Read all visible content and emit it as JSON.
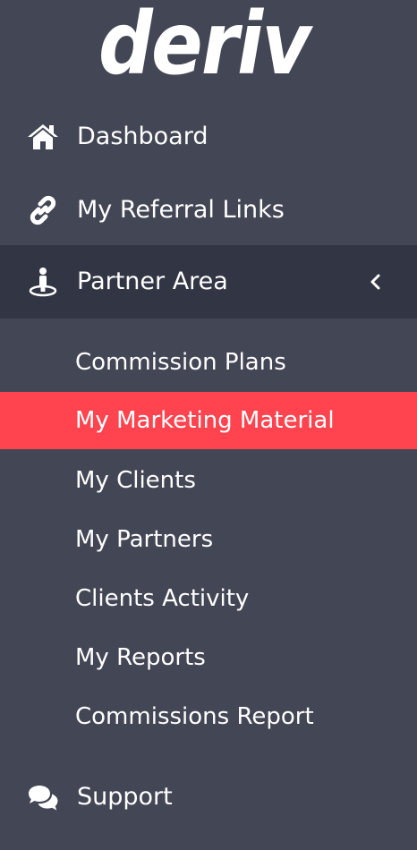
{
  "brand": {
    "logo_text": "deriv"
  },
  "nav": {
    "dashboard": {
      "label": "Dashboard",
      "icon": "home-icon"
    },
    "referral_links": {
      "label": "My Referral Links",
      "icon": "link-icon"
    },
    "partner_area": {
      "label": "Partner Area",
      "icon": "partner-icon",
      "expanded": true,
      "children": [
        {
          "label": "Commission Plans"
        },
        {
          "label": "My Marketing Material",
          "selected": true
        },
        {
          "label": "My Clients"
        },
        {
          "label": "My Partners"
        },
        {
          "label": "Clients Activity"
        },
        {
          "label": "My Reports"
        },
        {
          "label": "Commissions Report"
        }
      ]
    },
    "support": {
      "label": "Support",
      "icon": "chat-icon"
    }
  },
  "colors": {
    "sidebar_bg": "#434654",
    "active_parent_bg": "#323543",
    "selected_bg": "#ff444f",
    "text": "#ffffff"
  }
}
